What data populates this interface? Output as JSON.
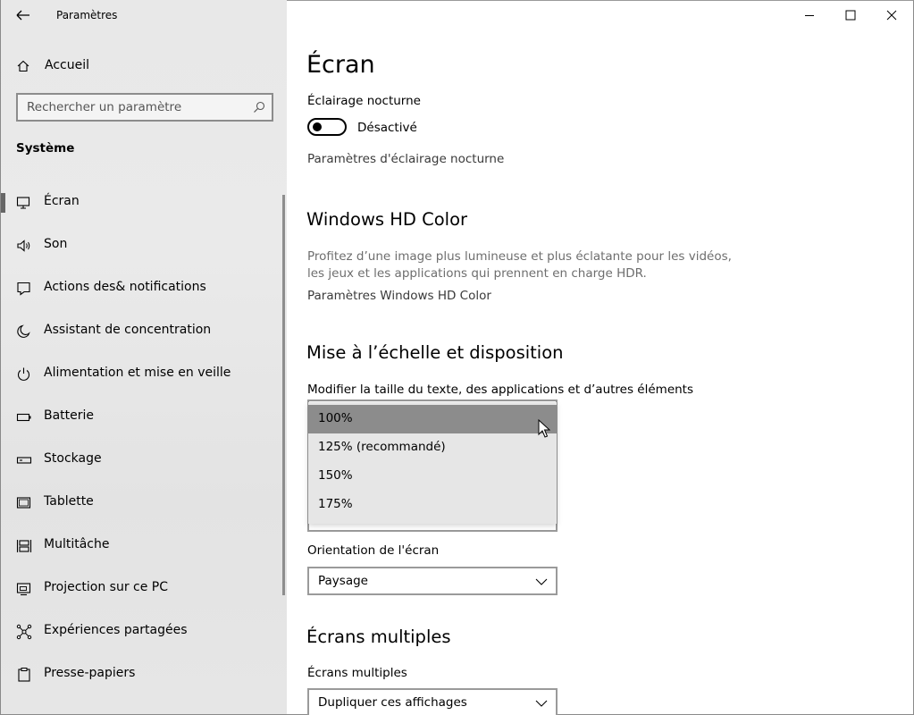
{
  "window": {
    "title": "Paramètres",
    "minimize_label": "Réduire",
    "maximize_label": "Agrandir",
    "close_label": "Fermer"
  },
  "sidebar": {
    "home_label": "Accueil",
    "search_placeholder": "Rechercher un paramètre",
    "section_title": "Système",
    "items": [
      {
        "label": "Écran",
        "icon": "monitor-icon",
        "selected": true
      },
      {
        "label": "Son",
        "icon": "speaker-icon"
      },
      {
        "label": "Actions des& notifications",
        "icon": "notification-icon"
      },
      {
        "label": "Assistant de concentration",
        "icon": "moon-icon"
      },
      {
        "label": "Alimentation et mise en veille",
        "icon": "power-icon"
      },
      {
        "label": "Batterie",
        "icon": "battery-icon"
      },
      {
        "label": "Stockage",
        "icon": "storage-icon"
      },
      {
        "label": "Tablette",
        "icon": "tablet-icon"
      },
      {
        "label": "Multitâche",
        "icon": "multitask-icon"
      },
      {
        "label": "Projection sur ce PC",
        "icon": "projection-icon"
      },
      {
        "label": "Expériences partagées",
        "icon": "shared-icon"
      },
      {
        "label": "Presse-papiers",
        "icon": "clipboard-icon"
      }
    ]
  },
  "main": {
    "page_title": "Écran",
    "night_light": {
      "label": "Éclairage nocturne",
      "state": "Désactivé",
      "settings_link": "Paramètres d'éclairage nocturne"
    },
    "hdr": {
      "title": "Windows HD Color",
      "description_line1": "Profitez d’une image plus lumineuse et plus éclatante pour les vidéos,",
      "description_line2": "les jeux et les applications qui prennent en charge HDR.",
      "settings_link": "Paramètres Windows HD Color"
    },
    "scale": {
      "title": "Mise à l’échelle et disposition",
      "size_label": "Modifier la taille du texte, des applications et d’autres éléments",
      "options": [
        "100%",
        "125% (recommandé)",
        "150%",
        "175%"
      ],
      "highlighted_option": "100%"
    },
    "orientation": {
      "label": "Orientation de l'écran",
      "value": "Paysage"
    },
    "multiple": {
      "title": "Écrans multiples",
      "label": "Écrans multiples",
      "value": "Dupliquer ces affichages"
    }
  },
  "colors": {
    "sidebar_bg": "#e8e8e8",
    "highlight": "#8c8c8c",
    "dropdown_bg": "#e6e6e6"
  }
}
